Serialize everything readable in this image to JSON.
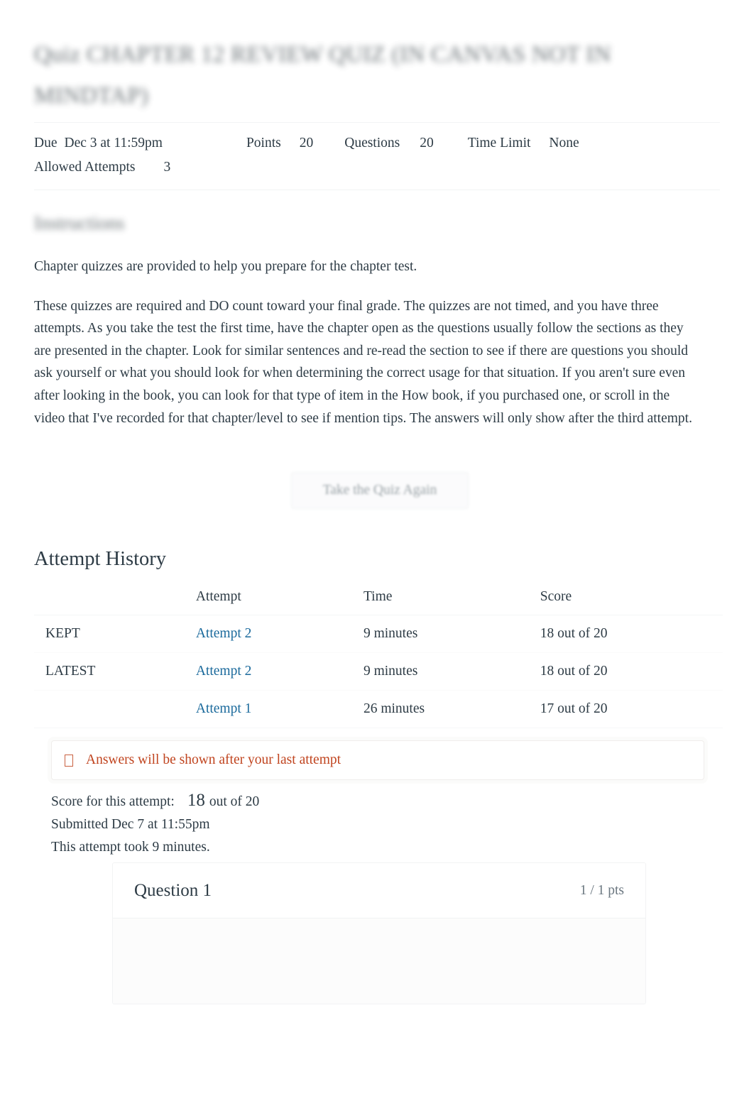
{
  "quiz": {
    "title": "Quiz CHAPTER 12 REVIEW QUIZ (IN CANVAS NOT IN MINDTAP)",
    "info": {
      "due_label": "Due",
      "due_value": "Dec 3 at 11:59pm",
      "points_label": "Points",
      "points_value": "20",
      "questions_label": "Questions",
      "questions_value": "20",
      "time_limit_label": "Time Limit",
      "time_limit_value": "None",
      "allowed_attempts_label": "Allowed Attempts",
      "allowed_attempts_value": "3"
    }
  },
  "instructions": {
    "heading": "Instructions",
    "paragraphs": [
      "Chapter quizzes are provided to help you prepare for the chapter test.",
      "These quizzes are required and DO count toward your final grade. The quizzes are not timed, and you have three attempts. As you take the test the first time, have the chapter open as the questions usually follow the sections as they are presented in the chapter. Look for similar sentences and re-read the section to see if there are questions you should ask yourself or what you should look for when determining the correct usage for that situation. If you aren't sure even after looking in the book, you can look for that type of item in the How book, if you purchased one, or scroll in the video that I've recorded for that chapter/level to see if mention tips. The answers will only show after the third attempt."
    ]
  },
  "actions": {
    "take_quiz_again": "Take the Quiz Again"
  },
  "attempt_history": {
    "heading": "Attempt History",
    "columns": {
      "flag": "",
      "attempt": "Attempt",
      "time": "Time",
      "score": "Score"
    },
    "rows": [
      {
        "flag": "KEPT",
        "attempt": "Attempt 2",
        "time": "9 minutes",
        "score": "18 out of 20"
      },
      {
        "flag": "LATEST",
        "attempt": "Attempt 2",
        "time": "9 minutes",
        "score": "18 out of 20"
      },
      {
        "flag": "",
        "attempt": "Attempt 1",
        "time": "26 minutes",
        "score": "17 out of 20"
      }
    ]
  },
  "alert": {
    "icon": "info-icon",
    "message": "Answers will be shown after your last attempt",
    "color": "#c0441f"
  },
  "score_summary": {
    "score_label": "Score for this attempt:",
    "score_value": "18",
    "score_out_of": "out of 20",
    "submitted": "Submitted Dec 7 at 11:55pm",
    "duration": "This attempt took 9 minutes."
  },
  "question": {
    "name": "Question 1",
    "points": "1 / 1 pts"
  },
  "colors": {
    "link": "#1b6a9c",
    "alert": "#c0441f",
    "text": "#2d3b45"
  }
}
